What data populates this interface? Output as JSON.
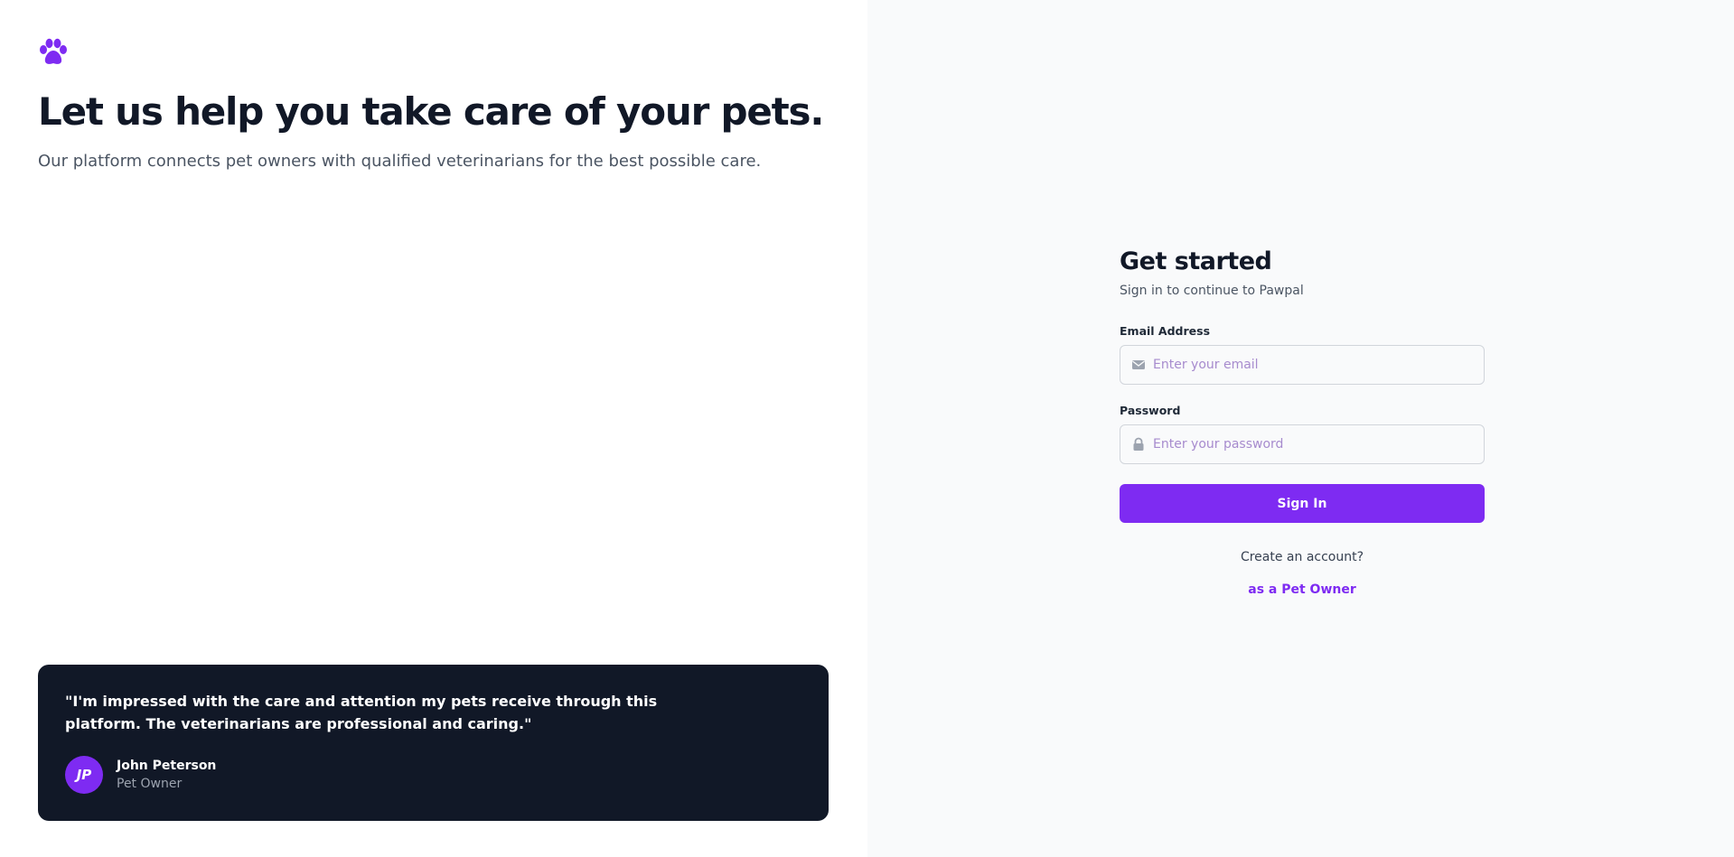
{
  "brand": {
    "logo_icon": "paw-icon",
    "accent_color": "#7e2bf2"
  },
  "hero": {
    "title": "Let us help you take care of your pets.",
    "subtitle": "Our platform connects pet owners with qualified veterinarians for the best possible care."
  },
  "testimonial": {
    "quote": "\"I'm impressed with the care and attention my pets receive through this platform. The veterinarians are professional and caring.\"",
    "avatar_initials": "JP",
    "author_name": "John Peterson",
    "author_role": "Pet Owner"
  },
  "login": {
    "title": "Get started",
    "subtitle": "Sign in to continue to Pawpal",
    "email_label": "Email Address",
    "email_placeholder": "Enter your email",
    "email_value": "",
    "email_icon": "envelope-icon",
    "password_label": "Password",
    "password_placeholder": "Enter your password",
    "password_value": "",
    "password_icon": "lock-icon",
    "signin_label": "Sign In",
    "create_account_text": "Create an account?",
    "pet_owner_link": "as a Pet Owner"
  }
}
